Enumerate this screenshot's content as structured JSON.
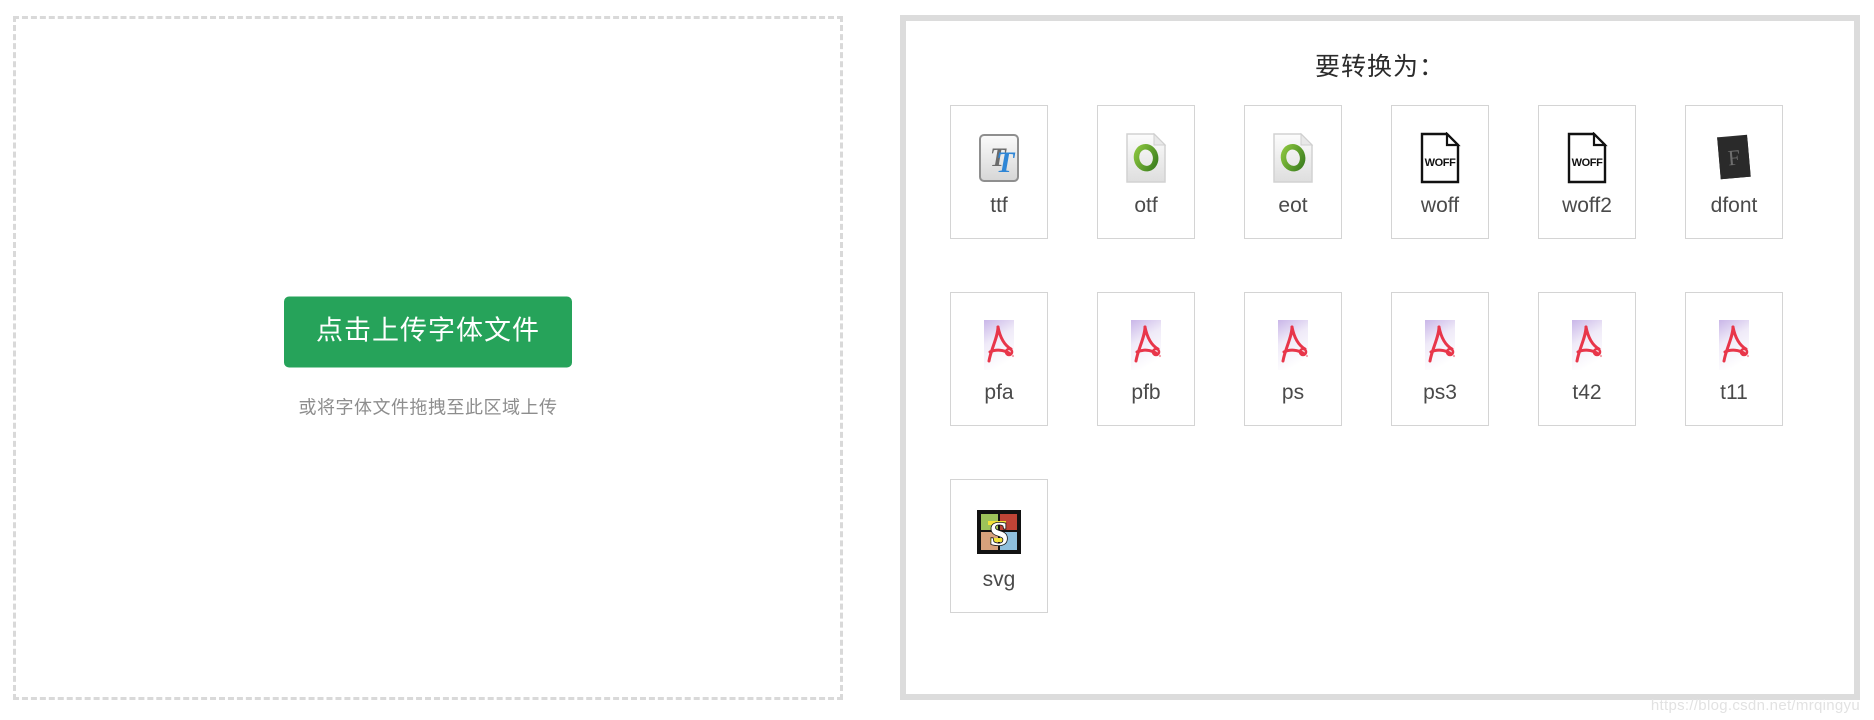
{
  "upload": {
    "button_label": "点击上传字体文件",
    "hint": "或将字体文件拖拽至此区域上传",
    "button_color": "#26a35a",
    "border_color": "#d9d9d9"
  },
  "convert": {
    "title": "要转换为：",
    "border_color": "#dcdcdc",
    "formats": [
      {
        "label": "ttf",
        "icon": "truetype-icon"
      },
      {
        "label": "otf",
        "icon": "opentype-icon"
      },
      {
        "label": "eot",
        "icon": "opentype-icon"
      },
      {
        "label": "woff",
        "icon": "woff-page-icon"
      },
      {
        "label": "woff2",
        "icon": "woff-page-icon"
      },
      {
        "label": "dfont",
        "icon": "dfont-icon"
      },
      {
        "label": "pfa",
        "icon": "postscript-pdf-icon"
      },
      {
        "label": "pfb",
        "icon": "postscript-pdf-icon"
      },
      {
        "label": "ps",
        "icon": "postscript-pdf-icon"
      },
      {
        "label": "ps3",
        "icon": "postscript-pdf-icon"
      },
      {
        "label": "t42",
        "icon": "postscript-pdf-icon"
      },
      {
        "label": "t11",
        "icon": "postscript-pdf-icon"
      },
      {
        "label": "svg",
        "icon": "svg-icon"
      }
    ]
  },
  "watermark": "https://blog.csdn.net/mrqingyu"
}
